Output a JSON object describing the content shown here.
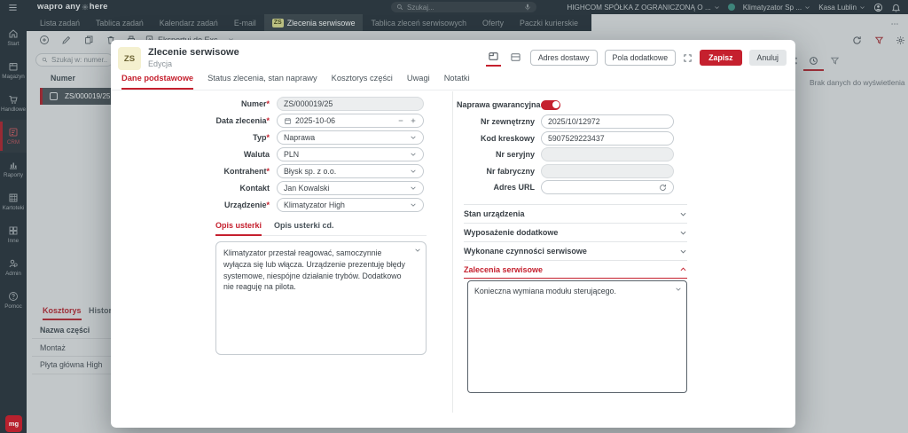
{
  "colors": {
    "brand_red": "#c5202e",
    "header_dark": "#2c3840",
    "accent_maroon": "#a22a35",
    "badge_yellow": "#f4f0cf"
  },
  "header": {
    "brand_prefix": "wapro any",
    "brand_suffix": "here",
    "search_placeholder": "Szukaj...",
    "company": "HIGHCOM SPÓŁKA Z OGRANICZONĄ O ...",
    "context_device": "Klimatyzator Sp ...",
    "context_cash": "Kasa Lublin"
  },
  "nav": {
    "badge": "ZS",
    "tabs": [
      {
        "label": "Lista zadań"
      },
      {
        "label": "Tablica zadań"
      },
      {
        "label": "Kalendarz zadań"
      },
      {
        "label": "E-mail"
      },
      {
        "label": "Zlecenia serwisowe"
      },
      {
        "label": "Tablica zleceń serwisowych"
      },
      {
        "label": "Oferty"
      },
      {
        "label": "Paczki kurierskie"
      }
    ]
  },
  "sidebar": {
    "items": [
      {
        "label": "Start"
      },
      {
        "label": "Magazyn"
      },
      {
        "label": "Handlowe"
      },
      {
        "label": "CRM"
      },
      {
        "label": "Raporty"
      },
      {
        "label": "Kartoteki"
      },
      {
        "label": "Inne"
      },
      {
        "label": "Admin"
      },
      {
        "label": "Pomoc"
      }
    ],
    "logo": "mg"
  },
  "toolbar": {
    "export_label": "Eksportuj do Exc..."
  },
  "list_panel": {
    "search_placeholder": "Szukaj w: numer...",
    "column_numer": "Numer",
    "selected_number": "ZS/000019/25"
  },
  "bottom_panel": {
    "tab_kosztorys": "Kosztorys",
    "tab_historia": "Historia zm",
    "column_name": "Nazwa części",
    "rows": [
      {
        "name": "Montaż"
      },
      {
        "name": "Płyta główna High"
      }
    ]
  },
  "right_panel": {
    "empty_text": "Brak danych do wyświetlenia"
  },
  "dialog": {
    "badge": "ZS",
    "title": "Zlecenie serwisowe",
    "subtitle": "Edycja",
    "btn_adres": "Adres dostawy",
    "btn_pola": "Pola dodatkowe",
    "btn_save": "Zapisz",
    "btn_cancel": "Anuluj",
    "tabs": [
      {
        "label": "Dane podstawowe"
      },
      {
        "label": "Status zlecenia, stan naprawy"
      },
      {
        "label": "Kosztorys części"
      },
      {
        "label": "Uwagi"
      },
      {
        "label": "Notatki"
      }
    ],
    "fields_left": [
      {
        "label": "Numer",
        "star": "*",
        "value": "ZS/000019/25"
      },
      {
        "label": "Data zlecenia",
        "star": "*",
        "value": "2025-10-06"
      },
      {
        "label": "Typ",
        "star": "*",
        "value": "Naprawa"
      },
      {
        "label": "Waluta",
        "star": "",
        "value": "PLN"
      },
      {
        "label": "Kontrahent",
        "star": "*",
        "value": "Błysk sp. z o.o."
      },
      {
        "label": "Kontakt",
        "star": "",
        "value": "Jan Kowalski"
      },
      {
        "label": "Urządzenie",
        "star": "*",
        "value": "Klimatyzator High"
      }
    ],
    "fields_right": [
      {
        "label": "Naprawa gwarancyjna",
        "value": "on"
      },
      {
        "label": "Nr zewnętrzny",
        "value": "2025/10/12972"
      },
      {
        "label": "Kod kreskowy",
        "value": "5907529223437"
      },
      {
        "label": "Nr seryjny",
        "value": ""
      },
      {
        "label": "Nr fabryczny",
        "value": ""
      },
      {
        "label": "Adres URL",
        "value": ""
      }
    ],
    "desc_tabs": [
      {
        "label": "Opis usterki"
      },
      {
        "label": "Opis usterki cd."
      }
    ],
    "desc_text": "Klimatyzator przestał reagować, samoczynnie wyłącza się lub włącza. Urządzenie prezentuję błędy systemowe, niespójne działanie trybów. Dodatkowo nie reaguję na pilota.",
    "sections": [
      {
        "label": "Stan urządzenia"
      },
      {
        "label": "Wyposażenie dodatkowe"
      },
      {
        "label": "Wykonane czynności serwisowe"
      },
      {
        "label": "Zalecenia serwisowe"
      }
    ],
    "zalecenia_text": "Konieczna wymiana modułu sterującego."
  }
}
